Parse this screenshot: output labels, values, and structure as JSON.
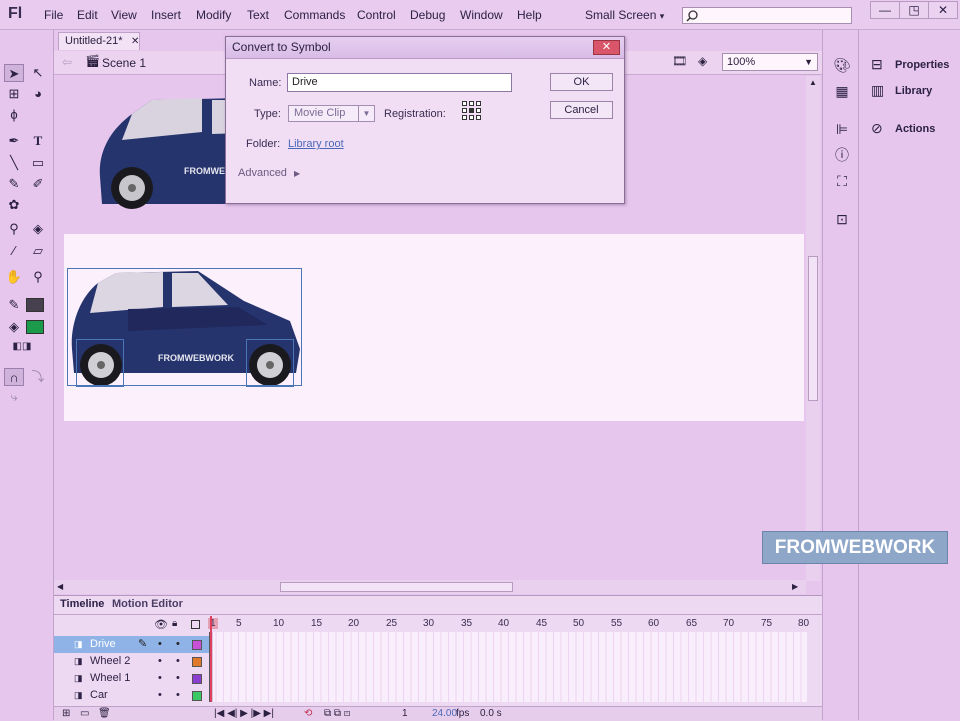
{
  "app": {
    "logo": "Fl"
  },
  "menu": [
    "File",
    "Edit",
    "View",
    "Insert",
    "Modify",
    "Text",
    "Commands",
    "Control",
    "Debug",
    "Window",
    "Help"
  ],
  "workspace": {
    "label": "Small Screen"
  },
  "window_controls": [
    "—",
    "◳",
    "✕"
  ],
  "document": {
    "tab_title": "Untitled-21*",
    "scene": "Scene 1",
    "zoom": "100%"
  },
  "dialog": {
    "title": "Convert to Symbol",
    "name_label": "Name:",
    "name_value": "Drive",
    "type_label": "Type:",
    "type_value": "Movie Clip",
    "registration_label": "Registration:",
    "folder_label": "Folder:",
    "folder_value": "Library root",
    "advanced_label": "Advanced",
    "ok_label": "OK",
    "cancel_label": "Cancel"
  },
  "panels": {
    "properties": "Properties",
    "library": "Library",
    "actions": "Actions"
  },
  "timeline": {
    "tabs": [
      "Timeline",
      "Motion Editor"
    ],
    "layers": [
      {
        "name": "Drive",
        "color": "#c84fd8",
        "selected": true
      },
      {
        "name": "Wheel 2",
        "color": "#e07a2a",
        "selected": false
      },
      {
        "name": "Wheel 1",
        "color": "#8a3fd0",
        "selected": false
      },
      {
        "name": "Car",
        "color": "#3cc864",
        "selected": false
      }
    ],
    "ruler": [
      "1",
      "5",
      "10",
      "15",
      "20",
      "25",
      "30",
      "35",
      "40",
      "45",
      "50",
      "55",
      "60",
      "65",
      "70",
      "75",
      "80"
    ],
    "frame": "1",
    "fps": "24.00",
    "fps_unit": "fps",
    "time": "0.0 s"
  },
  "car": {
    "brand_text": "FROMWEBWORK"
  },
  "watermark": "FROMWEBWORK"
}
